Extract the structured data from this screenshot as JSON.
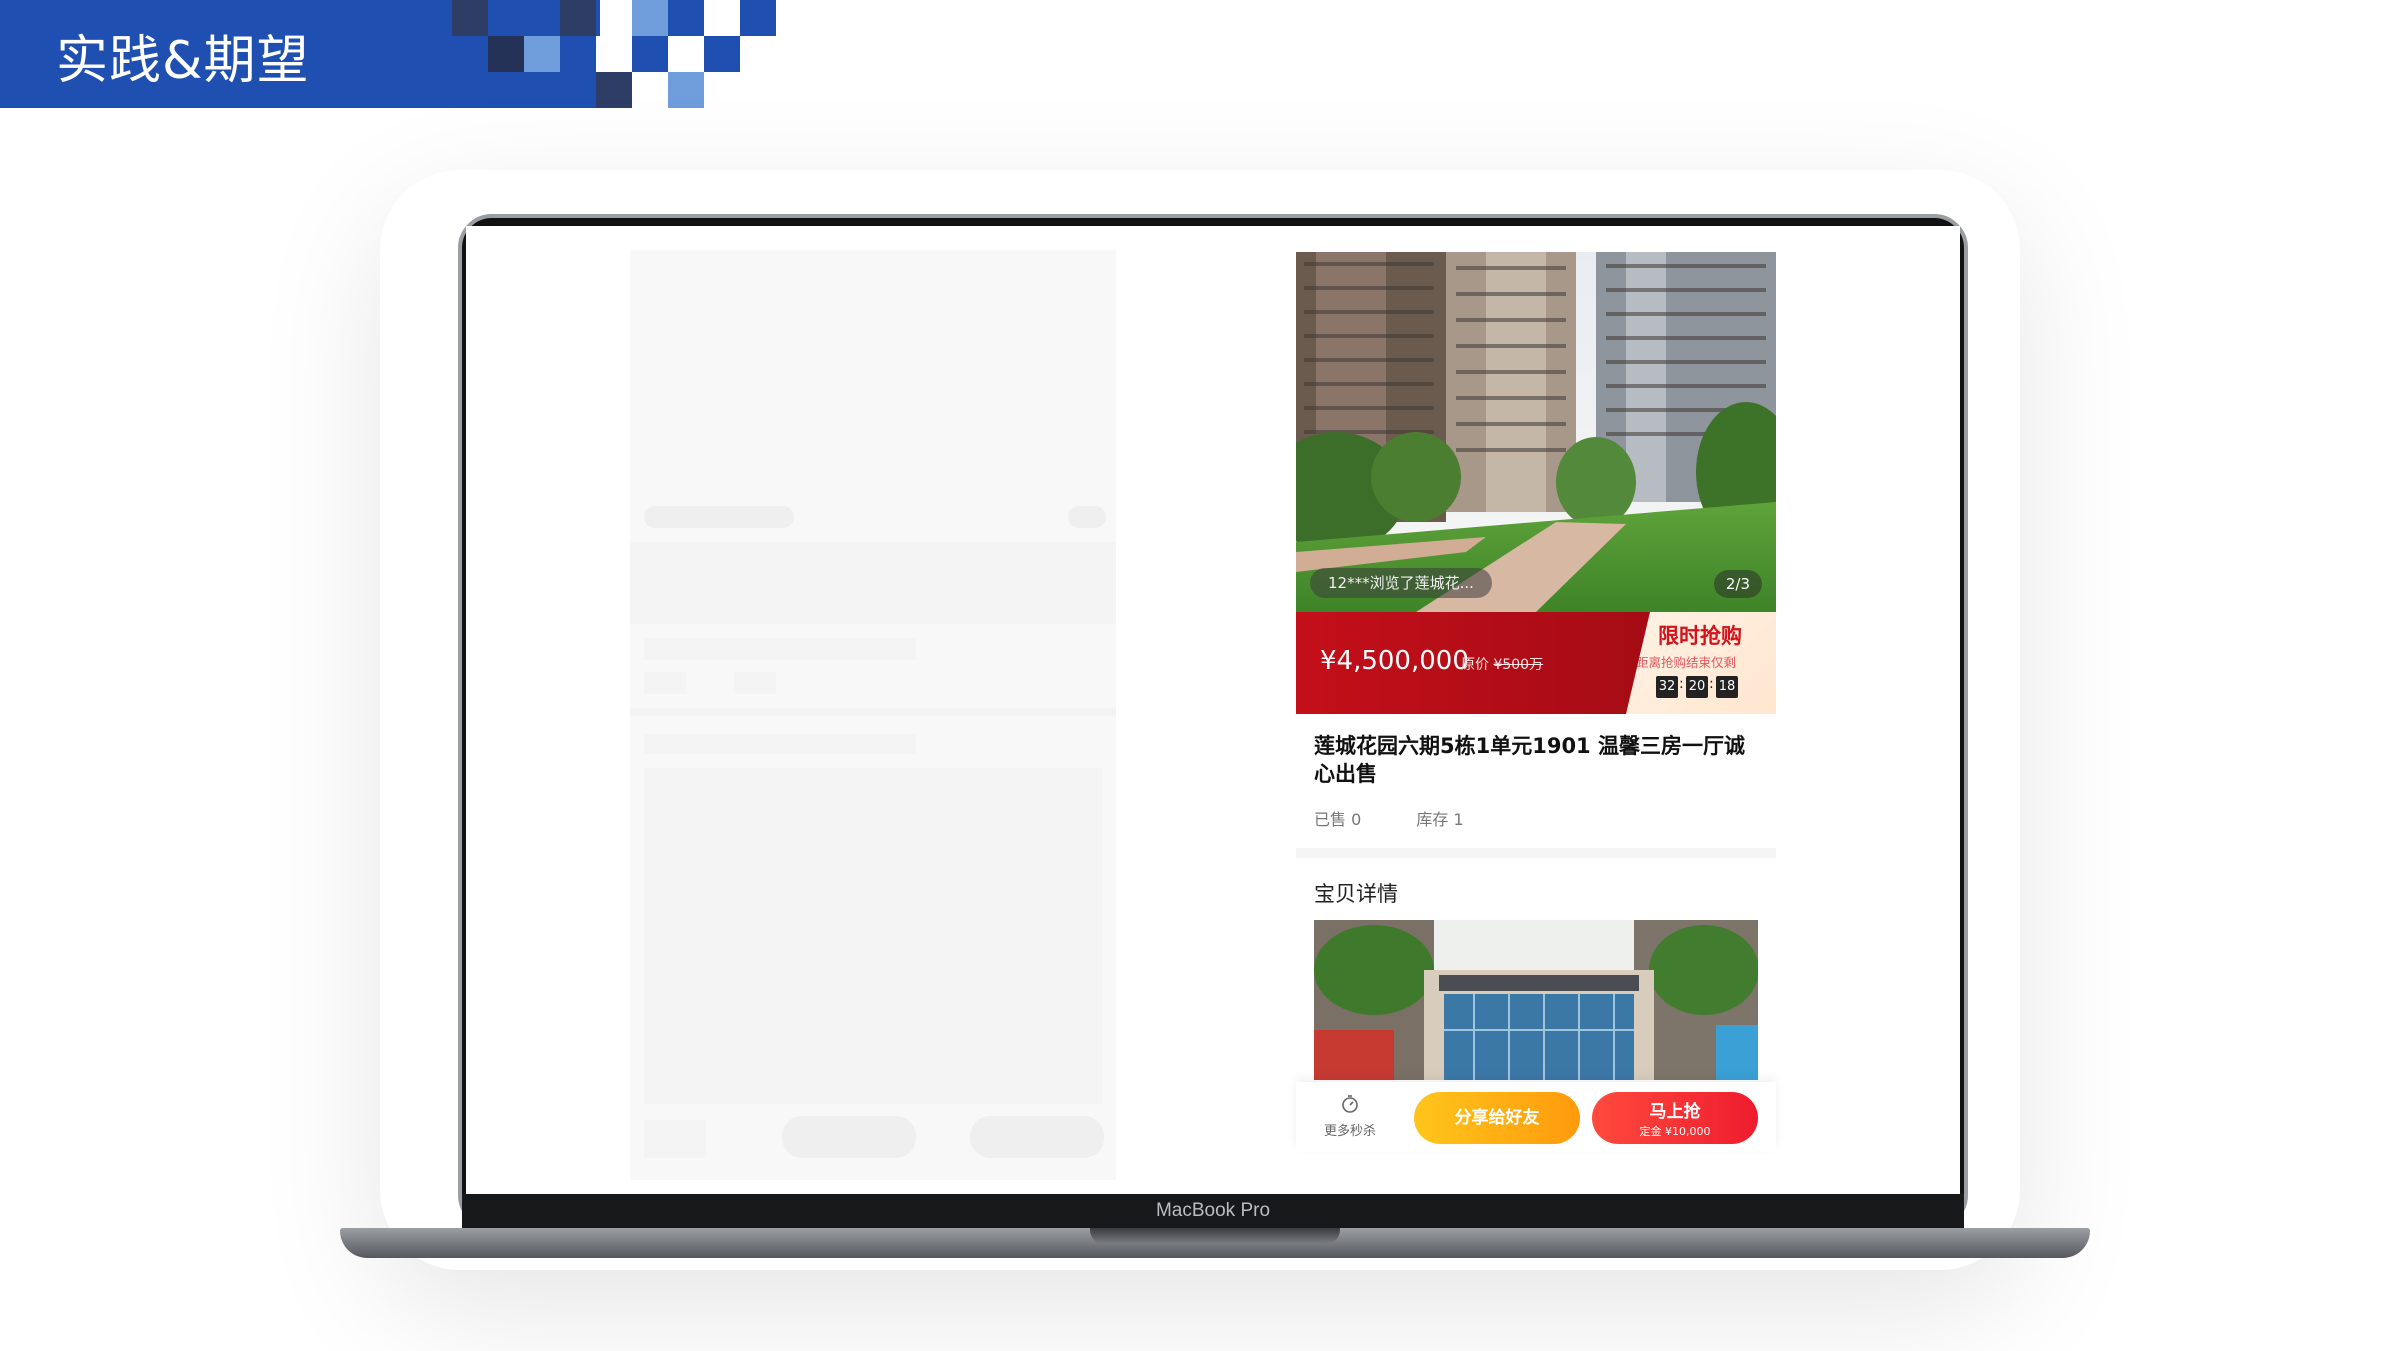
{
  "slide": {
    "title": "实践&期望"
  },
  "laptop": {
    "brand": "MacBook Pro"
  },
  "product": {
    "viewer_notice": "12***浏览了莲城花...",
    "image_index": "2/3",
    "price": "¥4,500,000",
    "original_price_label": "原价",
    "original_price": "¥500万",
    "flash_sale": {
      "title": "限时抢购",
      "subtitle": "距离抢购结束仅剩",
      "countdown": [
        "32",
        "20",
        "18"
      ]
    },
    "title": "莲城花园六期5栋1单元1901 温馨三房一厅诚心出售",
    "sold": "已售 0",
    "stock": "库存 1",
    "detail_heading": "宝贝详情"
  },
  "bottom_bar": {
    "more_label": "更多秒杀",
    "share_label": "分享给好友",
    "buy_label": "马上抢",
    "deposit": "定金 ¥10,000"
  },
  "colors": {
    "banner": "#1f4fb0",
    "price_bar": "#c40f1a",
    "share_button": "#ffb012",
    "buy_button": "#ee1c2e"
  },
  "icons": [
    "stopwatch-icon"
  ]
}
